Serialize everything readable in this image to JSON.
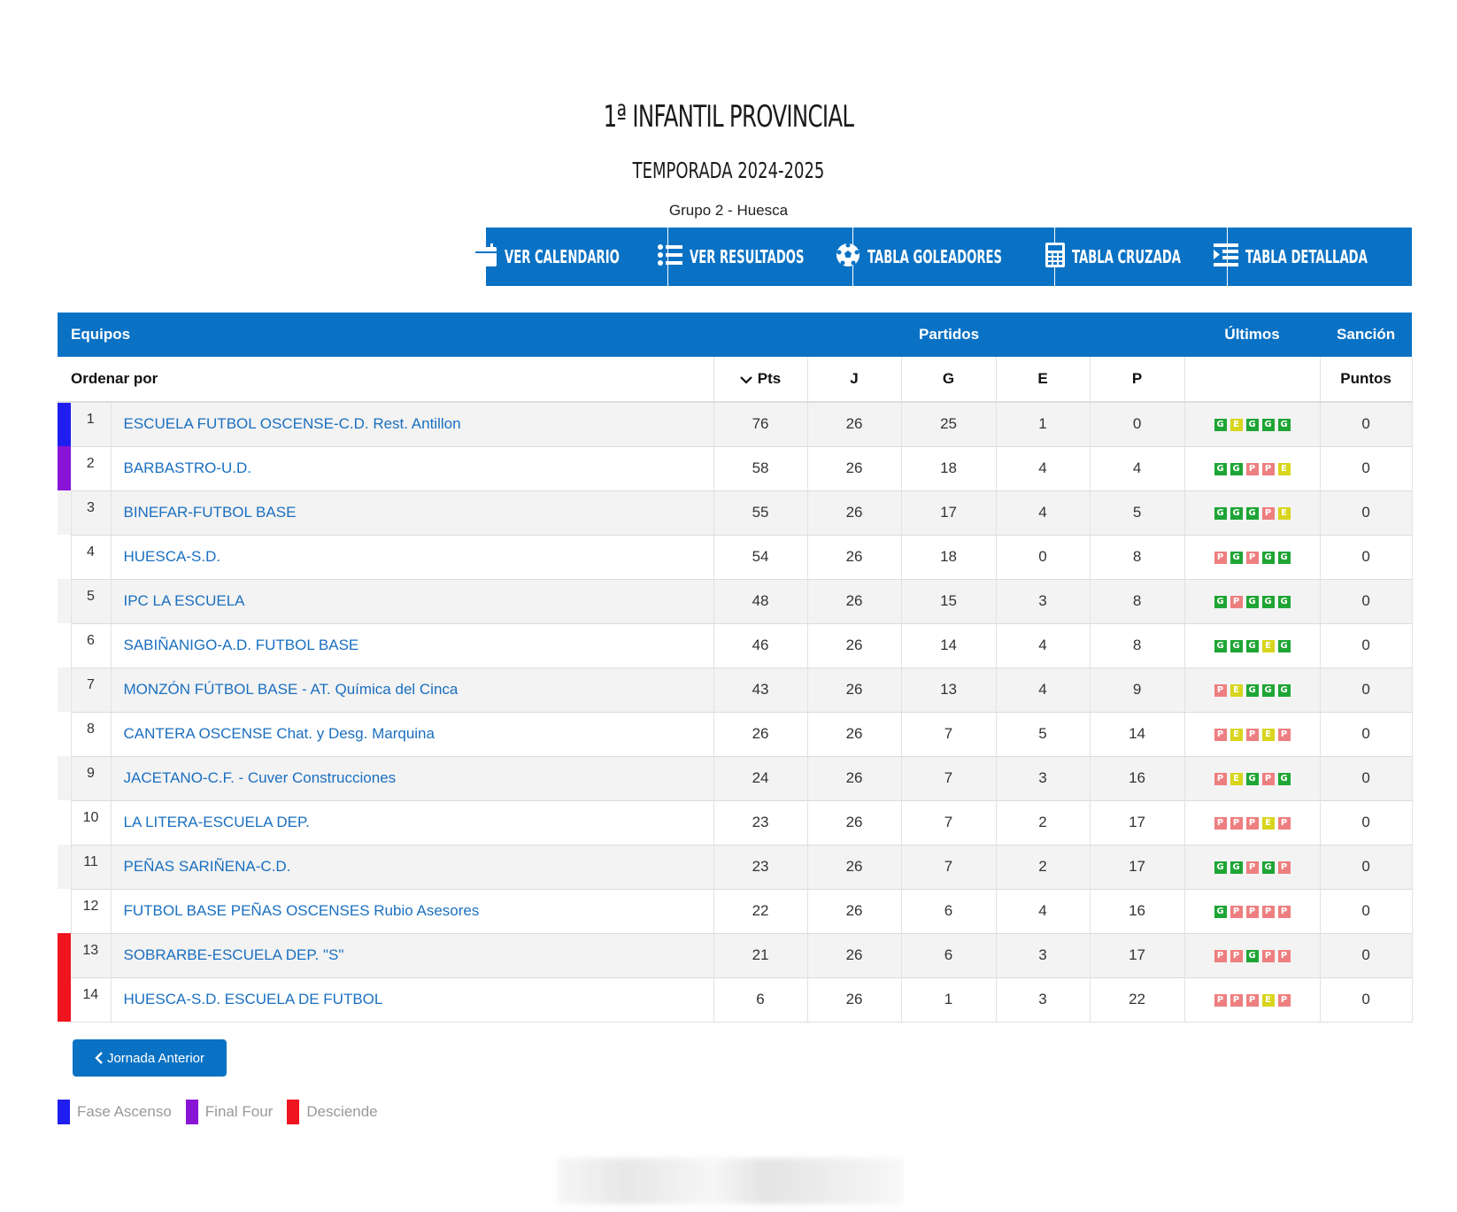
{
  "header": {
    "title": "1ª INFANTIL PROVINCIAL",
    "season": "TEMPORADA 2024-2025",
    "group": "Grupo 2 - Huesca"
  },
  "actions": [
    {
      "label": "VER CALENDARIO",
      "icon": "calendar-icon"
    },
    {
      "label": "VER RESULTADOS",
      "icon": "list-icon"
    },
    {
      "label": "TABLA GOLEADORES",
      "icon": "football-icon"
    },
    {
      "label": "TABLA CRUZADA",
      "icon": "calculator-icon"
    },
    {
      "label": "TABLA DETALLADA",
      "icon": "detailed-list-icon"
    }
  ],
  "table": {
    "head": {
      "teams": "Equipos",
      "matches": "Partidos",
      "last": "Últimos",
      "sanction": "Sanción"
    },
    "sub": {
      "order_by": "Ordenar por",
      "pts": "Pts",
      "j": "J",
      "g": "G",
      "e": "E",
      "p": "P",
      "points": "Puntos"
    },
    "rows": [
      {
        "pos": "1",
        "team": "ESCUELA FUTBOL OSCENSE-C.D. Rest. Antillon",
        "pts": "76",
        "j": "26",
        "g": "25",
        "e": "1",
        "p": "0",
        "last": [
          "G",
          "E",
          "G",
          "G",
          "G"
        ],
        "sanction": "0",
        "marker": "#1e1ef0"
      },
      {
        "pos": "2",
        "team": "BARBASTRO-U.D.",
        "pts": "58",
        "j": "26",
        "g": "18",
        "e": "4",
        "p": "4",
        "last": [
          "G",
          "G",
          "P",
          "P",
          "E"
        ],
        "sanction": "0",
        "marker": "#8a14d6"
      },
      {
        "pos": "3",
        "team": "BINEFAR-FUTBOL BASE",
        "pts": "55",
        "j": "26",
        "g": "17",
        "e": "4",
        "p": "5",
        "last": [
          "G",
          "G",
          "G",
          "P",
          "E"
        ],
        "sanction": "0",
        "marker": ""
      },
      {
        "pos": "4",
        "team": "HUESCA-S.D.",
        "pts": "54",
        "j": "26",
        "g": "18",
        "e": "0",
        "p": "8",
        "last": [
          "P",
          "G",
          "P",
          "G",
          "G"
        ],
        "sanction": "0",
        "marker": ""
      },
      {
        "pos": "5",
        "team": "IPC LA ESCUELA",
        "pts": "48",
        "j": "26",
        "g": "15",
        "e": "3",
        "p": "8",
        "last": [
          "G",
          "P",
          "G",
          "G",
          "G"
        ],
        "sanction": "0",
        "marker": ""
      },
      {
        "pos": "6",
        "team": "SABIÑANIGO-A.D. FUTBOL BASE",
        "pts": "46",
        "j": "26",
        "g": "14",
        "e": "4",
        "p": "8",
        "last": [
          "G",
          "G",
          "G",
          "E",
          "G"
        ],
        "sanction": "0",
        "marker": ""
      },
      {
        "pos": "7",
        "team": "MONZÓN FÚTBOL BASE - AT. Química del Cinca",
        "pts": "43",
        "j": "26",
        "g": "13",
        "e": "4",
        "p": "9",
        "last": [
          "P",
          "E",
          "G",
          "G",
          "G"
        ],
        "sanction": "0",
        "marker": ""
      },
      {
        "pos": "8",
        "team": "CANTERA OSCENSE Chat. y Desg. Marquina",
        "pts": "26",
        "j": "26",
        "g": "7",
        "e": "5",
        "p": "14",
        "last": [
          "P",
          "E",
          "P",
          "E",
          "P"
        ],
        "sanction": "0",
        "marker": ""
      },
      {
        "pos": "9",
        "team": "JACETANO-C.F. - Cuver Construcciones",
        "pts": "24",
        "j": "26",
        "g": "7",
        "e": "3",
        "p": "16",
        "last": [
          "P",
          "E",
          "G",
          "P",
          "G"
        ],
        "sanction": "0",
        "marker": ""
      },
      {
        "pos": "10",
        "team": "LA LITERA-ESCUELA DEP.",
        "pts": "23",
        "j": "26",
        "g": "7",
        "e": "2",
        "p": "17",
        "last": [
          "P",
          "P",
          "P",
          "E",
          "P"
        ],
        "sanction": "0",
        "marker": ""
      },
      {
        "pos": "11",
        "team": "PEÑAS SARIÑENA-C.D.",
        "pts": "23",
        "j": "26",
        "g": "7",
        "e": "2",
        "p": "17",
        "last": [
          "G",
          "G",
          "P",
          "G",
          "P"
        ],
        "sanction": "0",
        "marker": ""
      },
      {
        "pos": "12",
        "team": "FUTBOL BASE PEÑAS OSCENSES Rubio Asesores",
        "pts": "22",
        "j": "26",
        "g": "6",
        "e": "4",
        "p": "16",
        "last": [
          "G",
          "P",
          "P",
          "P",
          "P"
        ],
        "sanction": "0",
        "marker": ""
      },
      {
        "pos": "13",
        "team": "SOBRARBE-ESCUELA DEP. \"S\"",
        "pts": "21",
        "j": "26",
        "g": "6",
        "e": "3",
        "p": "17",
        "last": [
          "P",
          "P",
          "G",
          "P",
          "P"
        ],
        "sanction": "0",
        "marker": "#f0141e"
      },
      {
        "pos": "14",
        "team": "HUESCA-S.D. ESCUELA DE FUTBOL",
        "pts": "6",
        "j": "26",
        "g": "1",
        "e": "3",
        "p": "22",
        "last": [
          "P",
          "P",
          "P",
          "E",
          "P"
        ],
        "sanction": "0",
        "marker": "#f0141e"
      }
    ]
  },
  "result_colors": {
    "G": "#1fa535",
    "E": "#d8d51c",
    "P": "#ee7f80"
  },
  "prev_button": {
    "label": "Jornada Anterior"
  },
  "legend": [
    {
      "label": "Fase Ascenso",
      "color": "#1e1ef0"
    },
    {
      "label": "Final Four",
      "color": "#8a14d6"
    },
    {
      "label": "Desciende",
      "color": "#f0141e"
    }
  ],
  "colors": {
    "primary": "#0a72c4",
    "link": "#1a6fc0"
  }
}
